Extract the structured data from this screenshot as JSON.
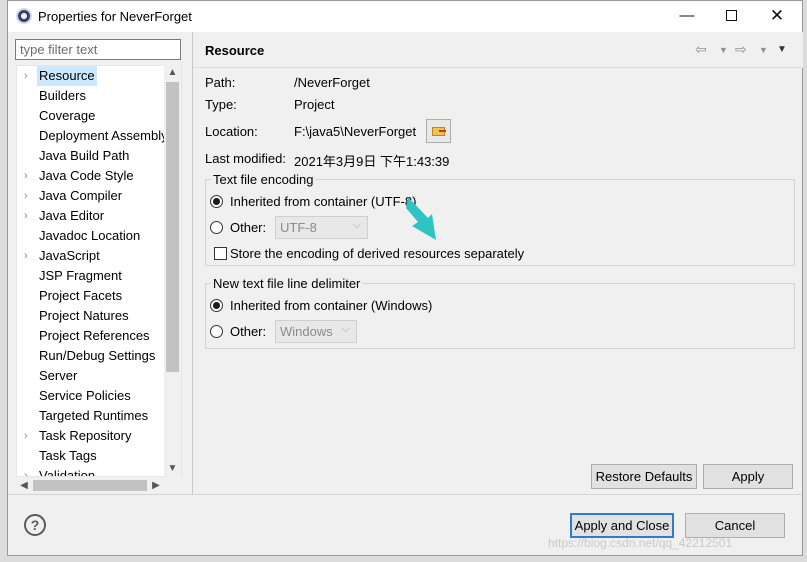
{
  "window": {
    "title": "Properties for NeverForget",
    "minimize_glyph": "—",
    "close_glyph": "✕"
  },
  "filter": {
    "placeholder": "type filter text"
  },
  "tree": {
    "items": [
      {
        "label": "Resource",
        "expandable": true,
        "selected": true
      },
      {
        "label": "Builders",
        "expandable": false
      },
      {
        "label": "Coverage",
        "expandable": false
      },
      {
        "label": "Deployment Assembly",
        "expandable": false
      },
      {
        "label": "Java Build Path",
        "expandable": false
      },
      {
        "label": "Java Code Style",
        "expandable": true
      },
      {
        "label": "Java Compiler",
        "expandable": true
      },
      {
        "label": "Java Editor",
        "expandable": true
      },
      {
        "label": "Javadoc Location",
        "expandable": false
      },
      {
        "label": "JavaScript",
        "expandable": true
      },
      {
        "label": "JSP Fragment",
        "expandable": false
      },
      {
        "label": "Project Facets",
        "expandable": false
      },
      {
        "label": "Project Natures",
        "expandable": false
      },
      {
        "label": "Project References",
        "expandable": false
      },
      {
        "label": "Run/Debug Settings",
        "expandable": false
      },
      {
        "label": "Server",
        "expandable": false
      },
      {
        "label": "Service Policies",
        "expandable": false
      },
      {
        "label": "Targeted Runtimes",
        "expandable": false
      },
      {
        "label": "Task Repository",
        "expandable": true
      },
      {
        "label": "Task Tags",
        "expandable": false
      },
      {
        "label": "Validation",
        "expandable": true
      }
    ],
    "expand_glyph": "›",
    "scroll_up": "▲",
    "scroll_down": "▼",
    "scroll_left": "◀",
    "scroll_right": "▶"
  },
  "page": {
    "title": "Resource",
    "nav_back": "⇦",
    "nav_fwd": "⇨",
    "nav_dd": "▼",
    "menu": "▼"
  },
  "props": {
    "path_label": "Path:",
    "path_value": "/NeverForget",
    "type_label": "Type:",
    "type_value": "Project",
    "location_label": "Location:",
    "location_value": "F:\\java5\\NeverForget",
    "modified_label": "Last modified:",
    "modified_value": "2021年3月9日 下午1:43:39"
  },
  "encoding": {
    "group_label": "Text file encoding",
    "inherited_label": "Inherited from container (UTF-8)",
    "inherited_selected": true,
    "other_label": "Other:",
    "other_value": "UTF-8",
    "store_label": "Store the encoding of derived resources separately",
    "store_checked": false
  },
  "delimiter": {
    "group_label": "New text file line delimiter",
    "inherited_label": "Inherited from container (Windows)",
    "inherited_selected": true,
    "other_label": "Other:",
    "other_value": "Windows"
  },
  "buttons": {
    "restore_defaults": "Restore Defaults",
    "apply": "Apply",
    "apply_and_close": "Apply and Close",
    "cancel": "Cancel"
  },
  "help": "?",
  "watermark": "https://blog.csdn.net/qq_42212501",
  "colors": {
    "selection": "#cce8ff",
    "default_button_border": "#2f7bd1",
    "annotation_arrow": "#2ec4c4"
  }
}
